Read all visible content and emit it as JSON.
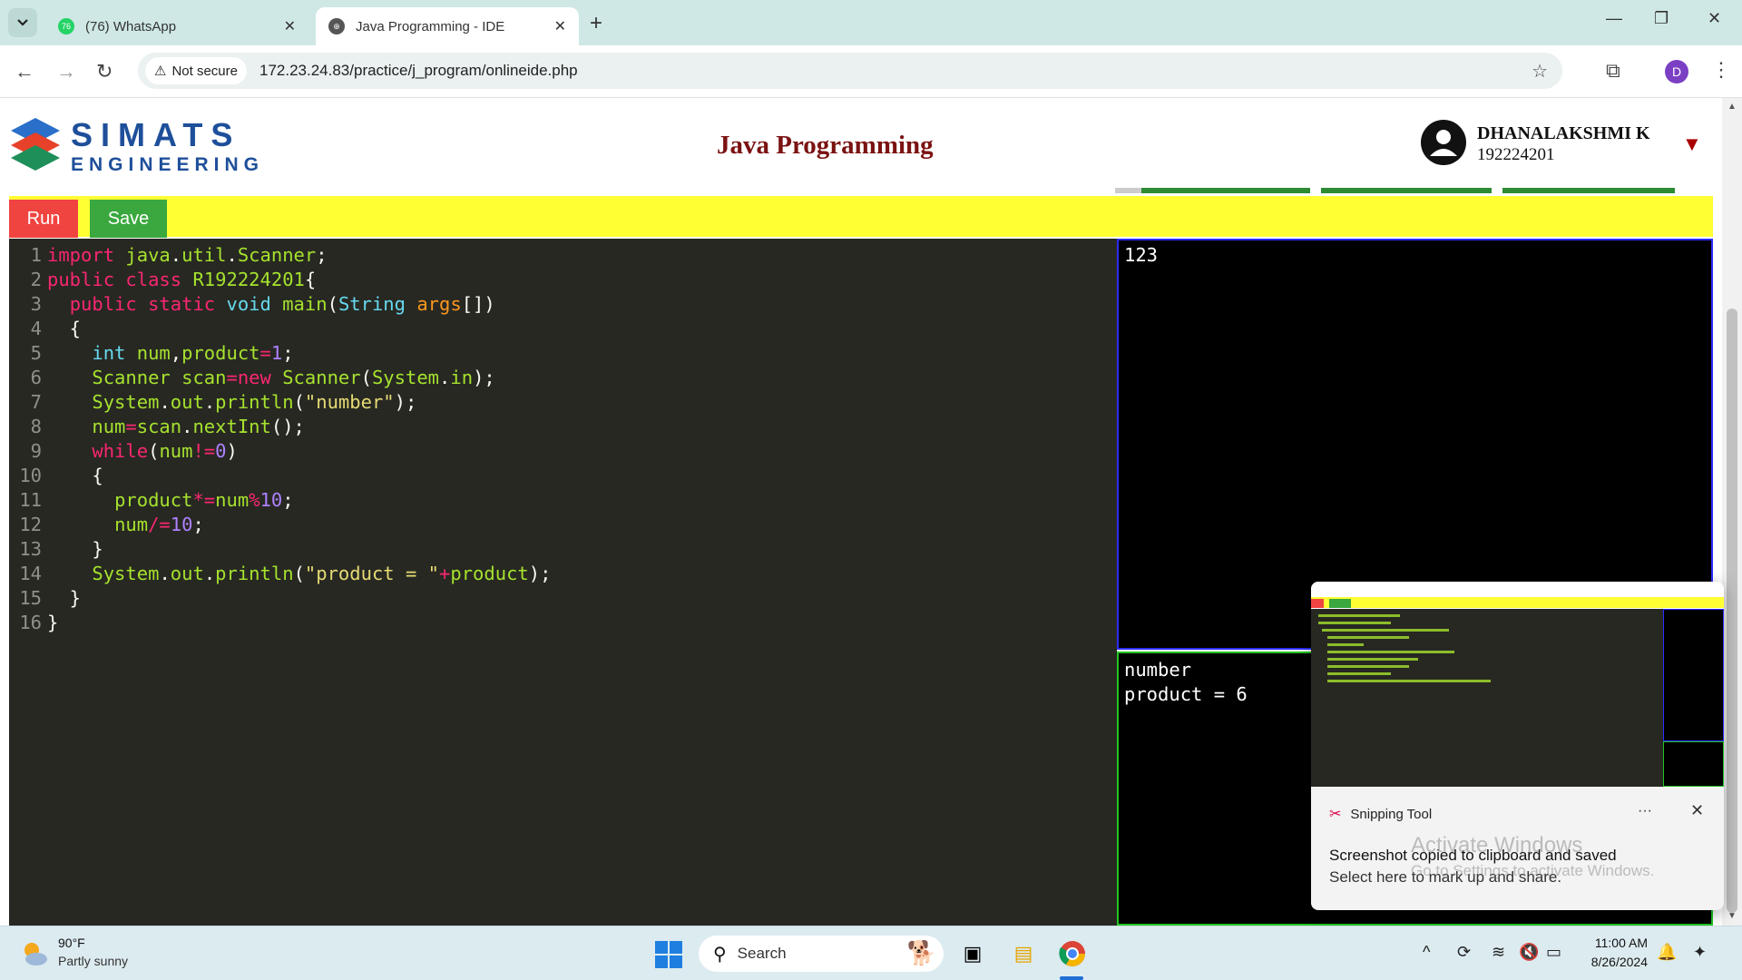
{
  "browser": {
    "tabs": [
      {
        "title": "(76) WhatsApp",
        "badge": "76",
        "active": false
      },
      {
        "title": "Java Programming - IDE",
        "active": true
      }
    ],
    "not_secure_label": "Not secure",
    "url": "172.23.24.83/practice/j_program/onlineide.php",
    "profile_initial": "D"
  },
  "header": {
    "logo_line1": "SIMATS",
    "logo_line2": "ENGINEERING",
    "title": "Java Programming",
    "user_name": "DHANALAKSHMI K",
    "user_id": "192224201"
  },
  "toolbar": {
    "run_label": "Run",
    "save_label": "Save"
  },
  "editor": {
    "line_numbers": [
      "1",
      "2",
      "3",
      "4",
      "5",
      "6",
      "7",
      "8",
      "9",
      "10",
      "11",
      "12",
      "13",
      "14",
      "15",
      "16"
    ]
  },
  "input_panel": {
    "text": "123"
  },
  "output_panel": {
    "lines": [
      "number",
      "product = 6"
    ]
  },
  "notification": {
    "app": "Snipping Tool",
    "line1": "Screenshot copied to clipboard and saved",
    "line2": "Select here to mark up and share."
  },
  "watermark": {
    "line1": "Activate Windows",
    "line2": "Go to Settings to activate Windows."
  },
  "taskbar": {
    "temperature": "90°F",
    "condition": "Partly sunny",
    "search_placeholder": "Search",
    "time": "11:00 AM",
    "date": "8/26/2024"
  },
  "colors": {
    "run": "#f04440",
    "save": "#3aa83e",
    "action_bar": "#ffff33",
    "title": "#7b1212",
    "editor_bg": "#272822"
  }
}
